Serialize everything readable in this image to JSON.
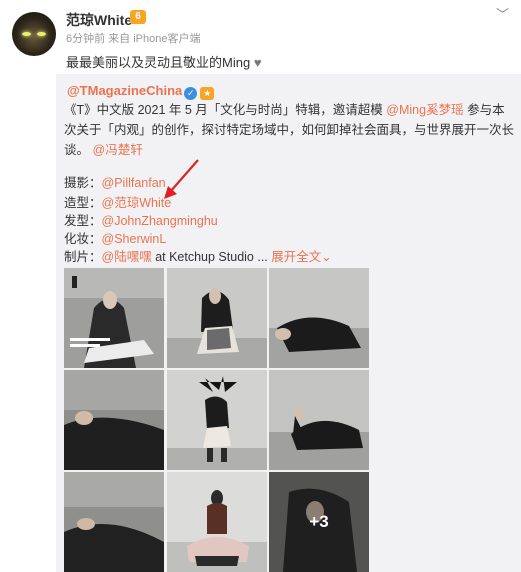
{
  "post": {
    "author": "范琼White",
    "vip_badge": "6",
    "time_source": "6分钟前 来自 iPhone客户端",
    "text": "最最美丽以及灵动且敬业的Ming",
    "heart": "♥"
  },
  "repost": {
    "author": "@TMagazineChina",
    "body_lines": [
      "《T》中文版 2021 年 5 月「文化与时尚」特辑，邀请超模",
      "@Ming奚梦瑶",
      "参与本次关于「内观」的创作，探讨特定场域中，如何卸掉社会面具，与世界展开一次长谈。",
      "@冯楚轩"
    ],
    "credits": [
      {
        "role": "摄影：",
        "name": "@Pillfanfan"
      },
      {
        "role": "造型：",
        "name": "@范琼White"
      },
      {
        "role": "发型：",
        "name": "@JohnZhangminghu"
      },
      {
        "role": "化妆：",
        "name": "@SherwinL"
      },
      {
        "role": "制片：",
        "name": "@陆嘿嘿",
        "suffix": " at Ketchup Studio ...",
        "expand": "展开全文"
      }
    ],
    "more_photos": "+3"
  },
  "colors": {
    "link": "#eb7350",
    "repost_bg": "#f2f2f5",
    "arrow": "#e02020"
  }
}
